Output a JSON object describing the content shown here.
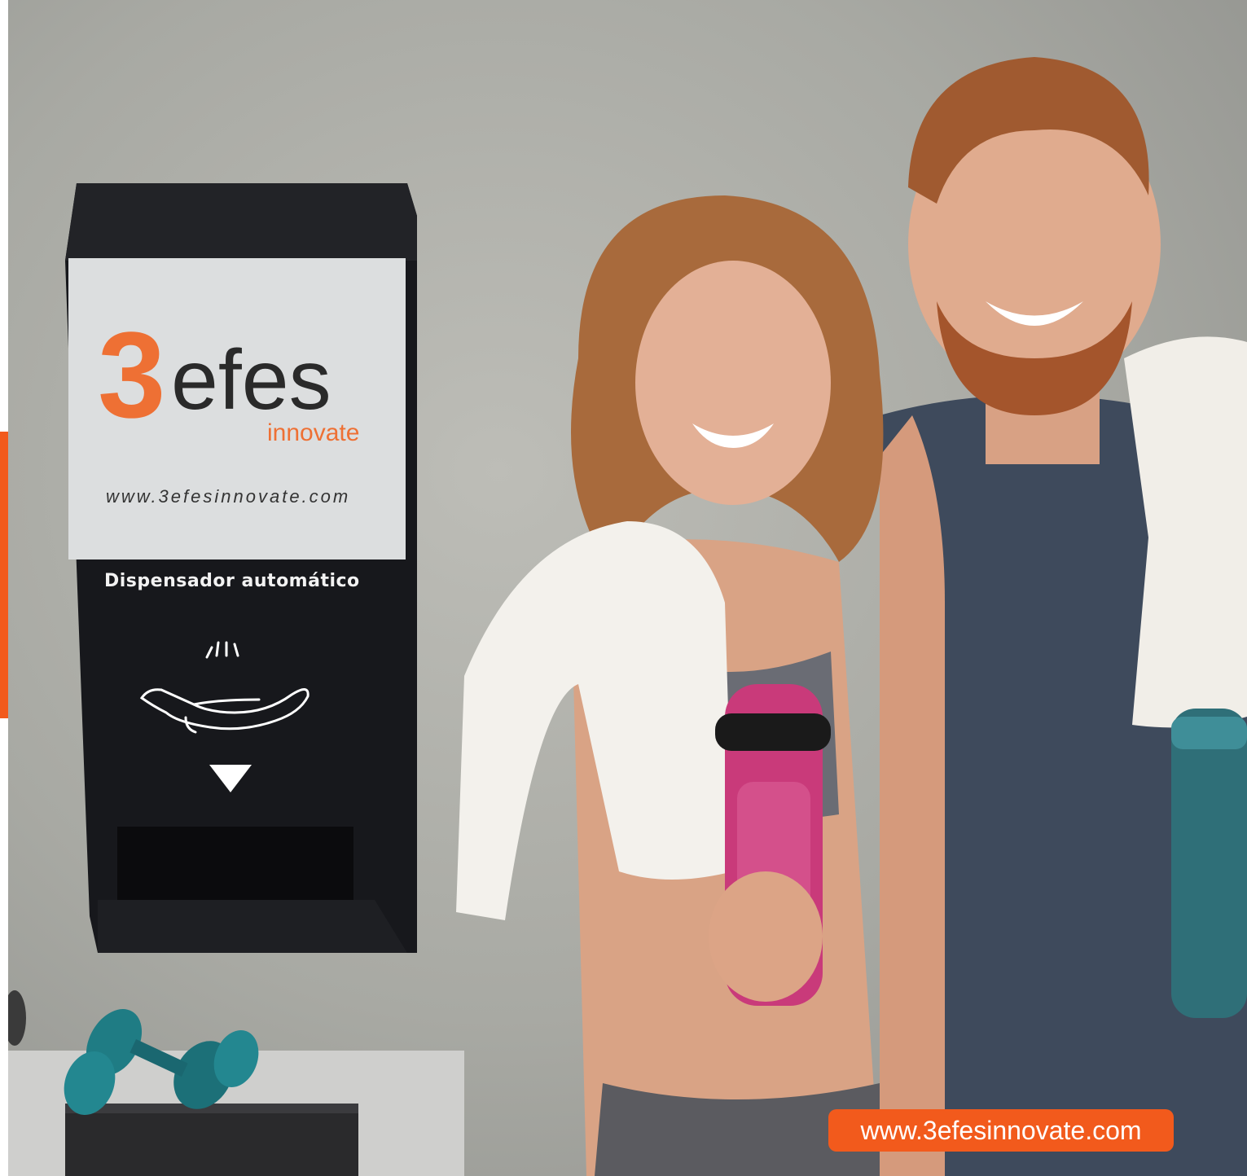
{
  "dispenser": {
    "logo_digit": "3",
    "logo_word": "efes",
    "logo_tagline": "innovate",
    "panel_url": "www.3efesinnovate.com",
    "label": "Dispensador automático",
    "hand_icon": "hand-sensor-icon",
    "arrow_icon": "down-arrow-icon"
  },
  "badge": {
    "url": "www.3efesinnovate.com"
  },
  "colors": {
    "brand_orange": "#f25a1c",
    "logo_orange": "#ee7034",
    "dispenser_body": "#17181c",
    "panel_background": "#dcdedf"
  }
}
